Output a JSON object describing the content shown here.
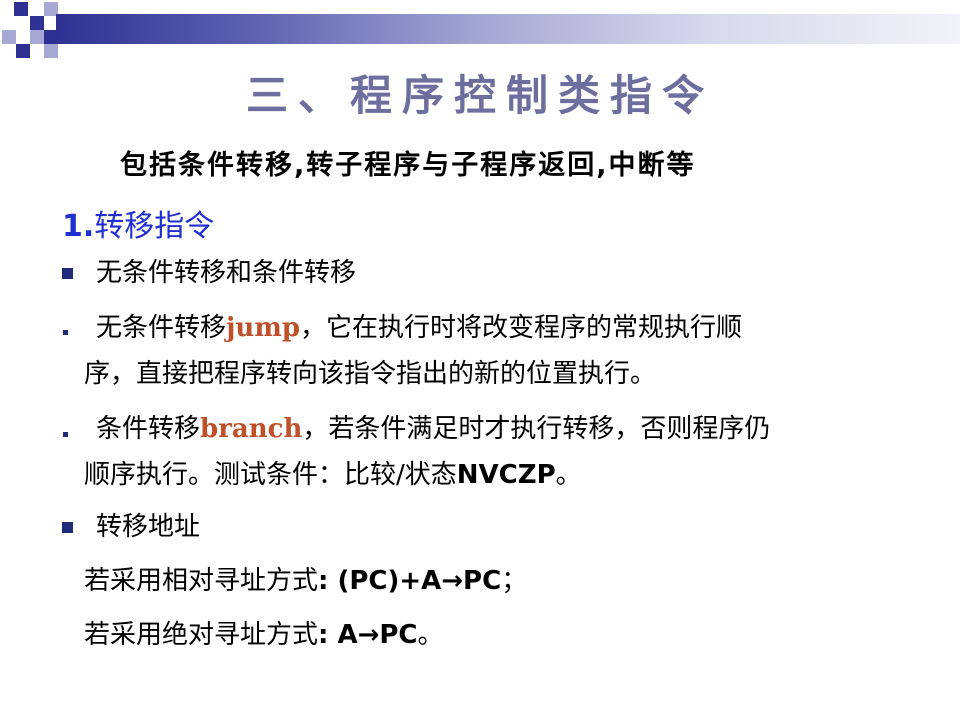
{
  "title": "三、程序控制类指令",
  "subtitle": "包括条件转移,转子程序与子程序返回,中断等",
  "section": {
    "number": "1.",
    "label": "转移指令"
  },
  "items": {
    "square1": "无条件转移和条件转移",
    "jump": {
      "before": "无条件转移",
      "keyword": "jump",
      "after_line1": "，它在执行时将改变程序的常规执行顺",
      "line2": "序，直接把程序转向该指令指出的新的位置执行。"
    },
    "branch": {
      "before": "条件转移",
      "keyword": "branch",
      "after_line1": "，若条件满足时才执行转移，否则程序仍",
      "line2_text": "顺序执行。测试条件：比较/状态",
      "line2_flags": "NVCZP",
      "line2_end": "。"
    },
    "square2": "转移地址",
    "relative": {
      "label": "若采用相对寻址方式",
      "formula": ": (PC)+A→PC",
      "end": "；"
    },
    "absolute": {
      "label": "若采用绝对寻址方式",
      "formula": ": A→PC",
      "end": "。"
    }
  },
  "colors": {
    "title": "#6d6d9e",
    "heading": "#1f2fd1",
    "keyword": "#c0502a",
    "bullet": "#1e2a7a"
  }
}
